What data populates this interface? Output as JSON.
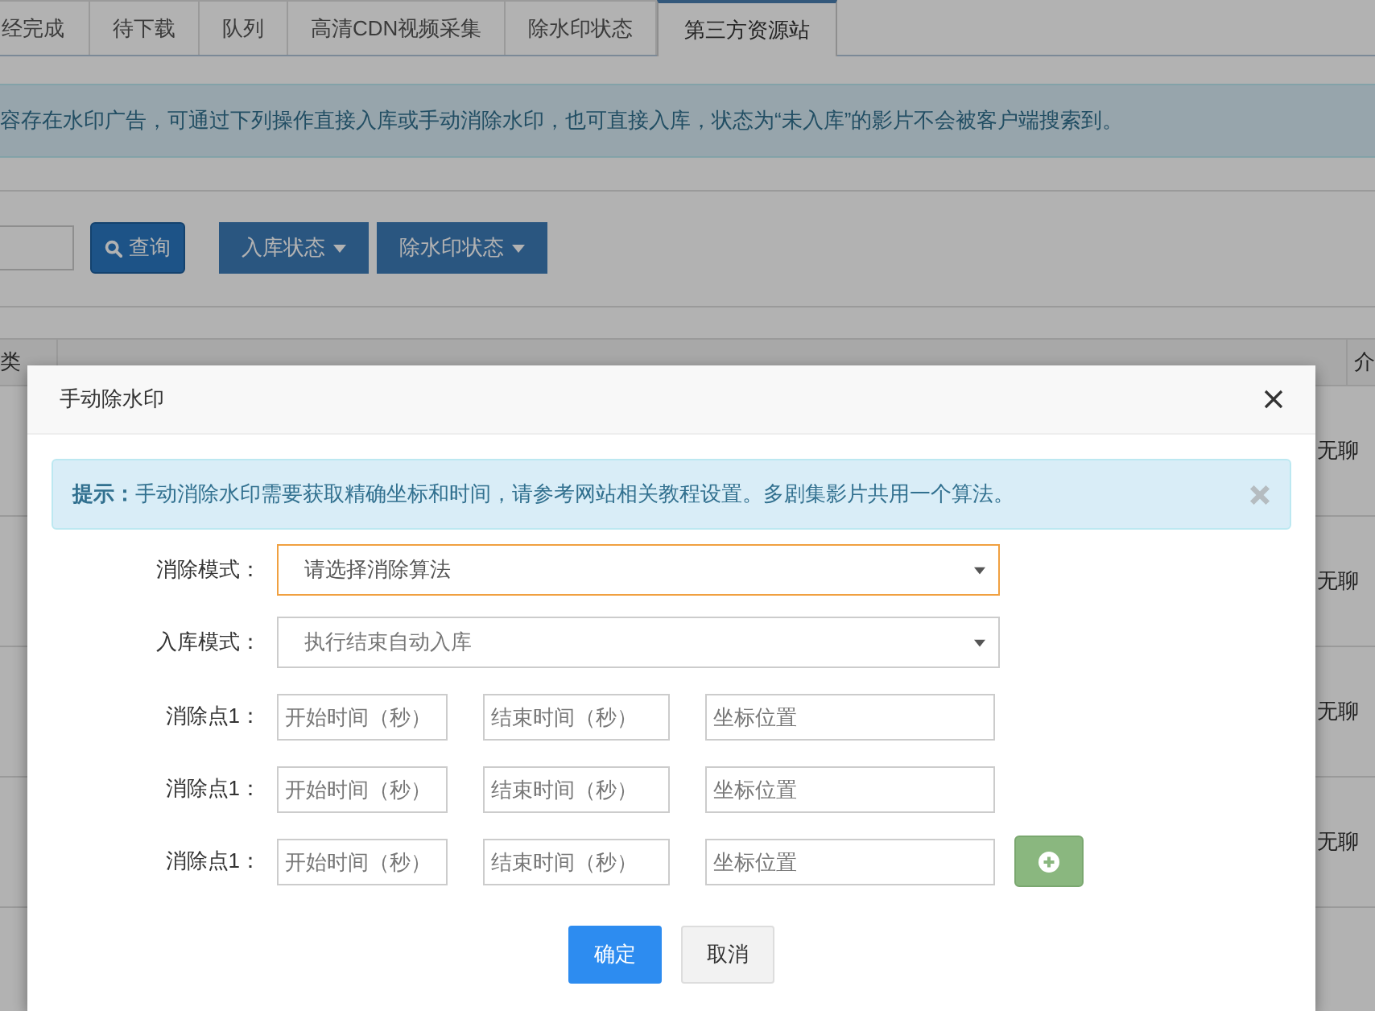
{
  "tabs": [
    {
      "label": "经完成",
      "selected": false
    },
    {
      "label": "待下载",
      "selected": false
    },
    {
      "label": "队列",
      "selected": false
    },
    {
      "label": "高清CDN视频采集",
      "selected": false
    },
    {
      "label": "除水印状态",
      "selected": false
    },
    {
      "label": "第三方资源站",
      "selected": true
    }
  ],
  "notice": "容存在水印广告，可通过下列操作直接入库或手动消除水印，也可直接入库，状态为“未入库”的影片不会被客户端搜索到。",
  "toolbar": {
    "search_button": "查询",
    "dropdowns": [
      "入库状态",
      "除水印状态"
    ]
  },
  "table": {
    "header_left": "类",
    "header_right": "介",
    "rows": [
      {
        "column_right": "无聊"
      },
      {
        "column_right": "无聊"
      },
      {
        "column_right": "无聊"
      },
      {
        "column_right": "无聊"
      }
    ]
  },
  "modal": {
    "title": "手动除水印",
    "alert": {
      "label": "提示：",
      "message": "手动消除水印需要获取精确坐标和时间，请参考网站相关教程设置。多剧集影片共用一个算法。"
    },
    "selects": [
      {
        "label": "消除模式：",
        "value": "请选择消除算法",
        "focused": true
      },
      {
        "label": "入库模式：",
        "value": "执行结束自动入库",
        "focused": false
      }
    ],
    "points": [
      {
        "label": "消除点1：",
        "start_placeholder": "开始时间（秒）",
        "end_placeholder": "结束时间（秒）",
        "position_placeholder": "坐标位置",
        "add_button": false
      },
      {
        "label": "消除点1：",
        "start_placeholder": "开始时间（秒）",
        "end_placeholder": "结束时间（秒）",
        "position_placeholder": "坐标位置",
        "add_button": false
      },
      {
        "label": "消除点1：",
        "start_placeholder": "开始时间（秒）",
        "end_placeholder": "结束时间（秒）",
        "position_placeholder": "坐标位置",
        "add_button": true
      }
    ],
    "buttons": [
      {
        "label": "确定",
        "kind": "primary"
      },
      {
        "label": "取消",
        "kind": "default"
      }
    ]
  }
}
